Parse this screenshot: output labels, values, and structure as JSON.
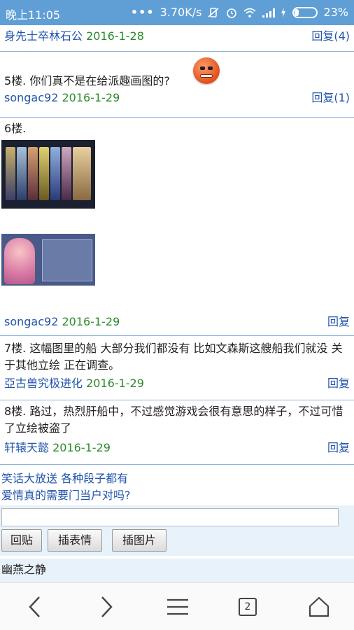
{
  "status_bar": {
    "time": "晚上11:05",
    "network_speed": "3.70K/s",
    "battery_percent": "23%",
    "icons": [
      "more-dots-icon",
      "vibrate-off-icon",
      "alarm-icon",
      "wifi-icon",
      "signal-icon",
      "charging-icon",
      "battery-icon"
    ]
  },
  "posts": [
    {
      "author": "身先士卒林石公",
      "date": "2016-1-28",
      "reply_label": "回复(4)"
    },
    {
      "text": "5楼. 你们真不是在给派趣画图的?",
      "author": "songac92",
      "date": "2016-1-29",
      "reply_label": "回复(1)",
      "emoji": "grinning-emoji"
    },
    {
      "text": "6楼.",
      "author": "songac92",
      "date": "2016-1-29",
      "reply_label": "回复"
    },
    {
      "text": "7楼. 这幅图里的船 大部分我们都没有 比如文森斯这艘船我们就没 关于其他立绘 正在调查。",
      "author": "亞古兽究极进化",
      "date": "2016-1-29",
      "reply_label": "回复"
    },
    {
      "text": "8楼. 路过，热烈肝船中，不过感觉游戏会很有意思的样子，不过可惜了立绘被盗了",
      "author": "轩辕天懿",
      "date": "2016-1-29",
      "reply_label": "回复"
    }
  ],
  "links": {
    "link1": "笑话大放送 各种段子都有",
    "link2": "爱情真的需要门当户对吗?"
  },
  "composer": {
    "input_value": "",
    "reply_button": "回贴",
    "emoji_button": "插表情",
    "image_button": "插图片"
  },
  "quick_box": {
    "name": "幽燕之静"
  },
  "bottom_nav": {
    "tab_count": "2"
  },
  "colors": {
    "status_bar": "#5f9fd6",
    "link": "#2255aa",
    "date": "#2a8a2a",
    "divider": "#8fb4d9"
  }
}
